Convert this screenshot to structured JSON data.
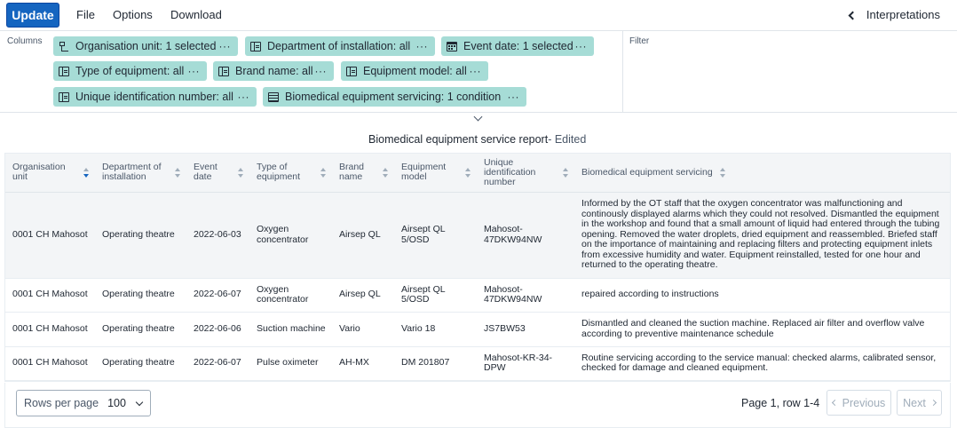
{
  "toolbar": {
    "update_label": "Update",
    "menu": [
      "File",
      "Options",
      "Download"
    ],
    "interpretations_label": "Interpretations"
  },
  "layout": {
    "columns_label": "Columns",
    "filter_label": "Filter",
    "chips": [
      {
        "label": "Organisation unit: 1 selected",
        "icon": "org-unit-tree-icon"
      },
      {
        "label": "Department of installation: all",
        "icon": "dimension-icon"
      },
      {
        "label": "Event date: 1 selected",
        "icon": "calendar-icon"
      },
      {
        "label": "Type of equipment: all",
        "icon": "dimension-icon"
      },
      {
        "label": "Brand name: all",
        "icon": "dimension-icon"
      },
      {
        "label": "Equipment model: all",
        "icon": "dimension-icon"
      },
      {
        "label": "Unique identification number: all",
        "icon": "dimension-icon"
      },
      {
        "label": "Biomedical equipment servicing: 1 condition",
        "icon": "list-icon"
      }
    ],
    "chip_menu_glyph": "···"
  },
  "visualization": {
    "title": "Biomedical equipment service report",
    "title_suffix": " - Edited"
  },
  "table": {
    "headers": [
      "Organisation unit",
      "Department of installation",
      "Event date",
      "Type of equipment",
      "Brand name",
      "Equipment model",
      "Unique identification number",
      "Biomedical equipment servicing"
    ],
    "sorted_column": 0,
    "rows": [
      [
        "0001 CH Mahosot",
        "Operating theatre",
        "2022-06-03",
        "Oxygen concentrator",
        "Airsep QL",
        "Airsept QL 5/OSD",
        "Mahosot-47DKW94NW",
        "Informed by the OT staff that the oxygen concentrator was malfunctioning and continously displayed alarms which they could not resolved. Dismantled the equipment in the workshop and found that a small amount of liquid had entered through the tubing opening. Removed the water droplets, dried equipment and reassembled. Briefed staff on the importance of maintaining and replacing filters and protecting equipment inlets from excessive humidity and water. Equipment reinstalled, tested for one hour and returned to the operating theatre."
      ],
      [
        "0001 CH Mahosot",
        "Operating theatre",
        "2022-06-07",
        "Oxygen concentrator",
        "Airsep QL",
        "Airsept QL 5/OSD",
        "Mahosot-47DKW94NW",
        "repaired according to instructions"
      ],
      [
        "0001 CH Mahosot",
        "Operating theatre",
        "2022-06-06",
        "Suction machine",
        "Vario",
        "Vario 18",
        "JS7BW53",
        "Dismantled and cleaned the suction machine. Replaced air filter and overflow valve according to preventive maintenance schedule"
      ],
      [
        "0001 CH Mahosot",
        "Operating theatre",
        "2022-06-07",
        "Pulse oximeter",
        "AH-MX",
        "DM 201807",
        "Mahosot-KR-34-DPW",
        "Routine servicing according to the service manual: checked alarms, calibrated sensor, checked for damage and cleaned equipment."
      ]
    ]
  },
  "pagination": {
    "rows_per_page_label": "Rows per page",
    "rows_per_page_value": "100",
    "page_info": "Page 1, row 1-4",
    "previous_label": "Previous",
    "next_label": "Next"
  }
}
